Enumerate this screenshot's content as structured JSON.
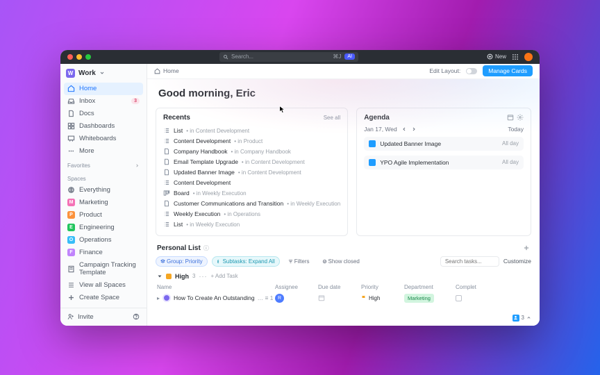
{
  "titlebar": {
    "search_placeholder": "Search...",
    "shortcut": "⌘J",
    "ai_label": "AI",
    "new_label": "New"
  },
  "workspace": {
    "initial": "W",
    "name": "Work"
  },
  "nav": {
    "home": "Home",
    "inbox": "Inbox",
    "inbox_badge": "3",
    "docs": "Docs",
    "dashboards": "Dashboards",
    "whiteboards": "Whiteboards",
    "more": "More"
  },
  "sections": {
    "favorites": "Favorites",
    "spaces": "Spaces"
  },
  "spaces": [
    {
      "label": "Everything",
      "initial": "",
      "color": "#6b7280",
      "type": "everything"
    },
    {
      "label": "Marketing",
      "initial": "M",
      "color": "#f472b6"
    },
    {
      "label": "Product",
      "initial": "P",
      "color": "#fb923c"
    },
    {
      "label": "Engineering",
      "initial": "E",
      "color": "#22c55e"
    },
    {
      "label": "Operations",
      "initial": "O",
      "color": "#38bdf8"
    },
    {
      "label": "Finance",
      "initial": "F",
      "color": "#c084fc"
    },
    {
      "label": "Campaign Tracking Template",
      "initial": "",
      "color": "#2a2e34",
      "type": "template"
    },
    {
      "label": "View all Spaces",
      "type": "link"
    },
    {
      "label": "Create Space",
      "type": "create"
    }
  ],
  "sidebar_footer": {
    "invite": "Invite"
  },
  "topbar": {
    "breadcrumb": "Home",
    "edit_layout": "Edit Layout:",
    "manage_cards": "Manage Cards"
  },
  "greeting": "Good morning, Eric",
  "recents": {
    "title": "Recents",
    "see_all": "See all",
    "items": [
      {
        "icon": "list",
        "name": "List",
        "loc": "• in Content Development"
      },
      {
        "icon": "list",
        "name": "Content Development",
        "loc": "• in Product"
      },
      {
        "icon": "doc",
        "name": "Company Handbook",
        "loc": "• in Company Handbook"
      },
      {
        "icon": "doc",
        "name": "Email Template Upgrade",
        "loc": "• in Content Development"
      },
      {
        "icon": "doc",
        "name": "Updated Banner Image",
        "loc": "• in Content Development"
      },
      {
        "icon": "list",
        "name": "Content Development",
        "loc": ""
      },
      {
        "icon": "board",
        "name": "Board",
        "loc": "• in Weekly Execution"
      },
      {
        "icon": "doc",
        "name": "Customer Communications and Transition",
        "loc": "• in Weekly Execution"
      },
      {
        "icon": "list",
        "name": "Weekly Execution",
        "loc": "• in Operations"
      },
      {
        "icon": "list",
        "name": "List",
        "loc": "• in Weekly Execution"
      }
    ]
  },
  "agenda": {
    "title": "Agenda",
    "date": "Jan 17, Wed",
    "today": "Today",
    "items": [
      {
        "title": "Updated Banner Image",
        "time": "All day"
      },
      {
        "title": "YPO Agile Implementation",
        "time": "All day"
      }
    ]
  },
  "plist": {
    "title": "Personal List",
    "info_icon": "ⓘ",
    "group_chip": "Group: Priority",
    "sub_chip": "Subtasks: Expand All",
    "filters": "Filters",
    "show_closed": "Show closed",
    "search_placeholder": "Search tasks...",
    "customize": "Customize",
    "group": {
      "label": "High",
      "count": "3",
      "add": "+ Add Task"
    },
    "columns": {
      "name": "Name",
      "assignee": "Assignee",
      "due": "Due date",
      "priority": "Priority",
      "dept": "Department",
      "complete": "Complet"
    },
    "row": {
      "name": "How To Create An Outstanding",
      "more": "… ≡ 1",
      "assignee_initial": "R",
      "priority": "High",
      "dept": "Marketing"
    },
    "floating_count": "3"
  }
}
